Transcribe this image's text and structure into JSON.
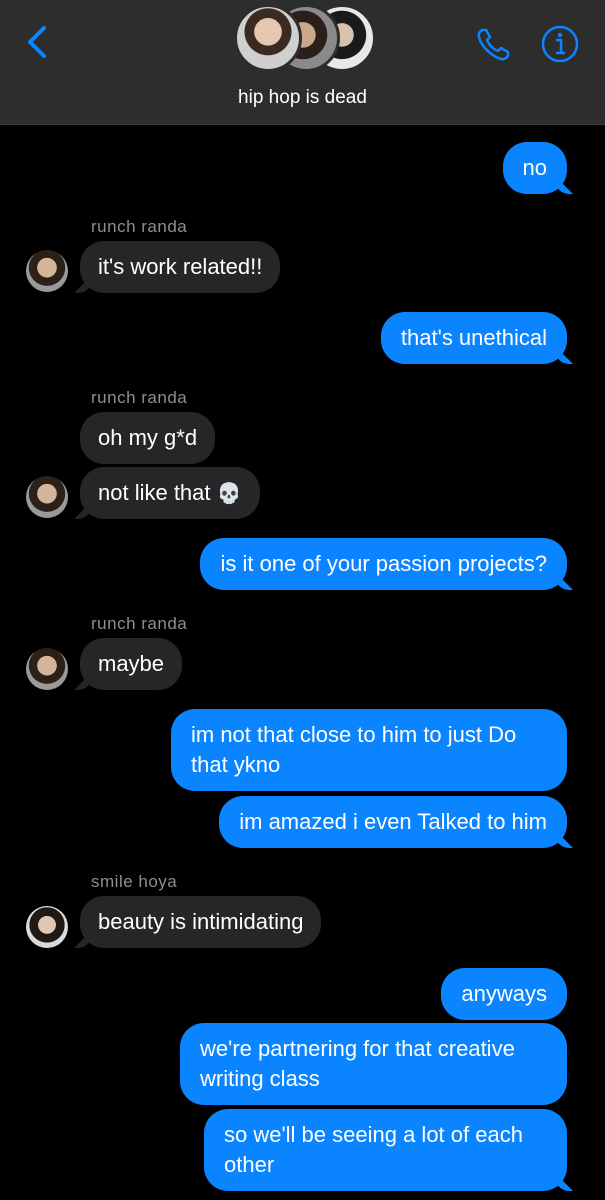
{
  "header": {
    "title": "hip hop is dead",
    "back_icon": "chevron-left-icon",
    "call_icon": "phone-icon",
    "info_icon": "info-icon",
    "accent_color": "#0b84ff"
  },
  "messages": [
    {
      "from": "me",
      "text": "no"
    },
    {
      "from": "runch randa",
      "sender_label": "runch randa",
      "text": "it's work related!!"
    },
    {
      "from": "me",
      "text": "that's unethical"
    },
    {
      "from": "runch randa",
      "sender_label": "runch randa",
      "text": "oh my g*d"
    },
    {
      "from": "runch randa",
      "text": "not like that",
      "emoji": "💀"
    },
    {
      "from": "me",
      "text": "is it one of your passion projects?"
    },
    {
      "from": "runch randa",
      "sender_label": "runch randa",
      "text": "maybe"
    },
    {
      "from": "me",
      "lines": [
        "im not that close to him to just Do",
        "that ykno"
      ]
    },
    {
      "from": "me",
      "text": "im amazed i even Talked to him"
    },
    {
      "from": "smile hoya",
      "sender_label": "smile hoya",
      "text": "beauty is intimidating"
    },
    {
      "from": "me",
      "text": "anyways"
    },
    {
      "from": "me",
      "lines": [
        "we're partnering for that creative",
        "writing class"
      ]
    },
    {
      "from": "me",
      "lines": [
        "so we'll be seeing a lot of each",
        "other"
      ]
    }
  ]
}
